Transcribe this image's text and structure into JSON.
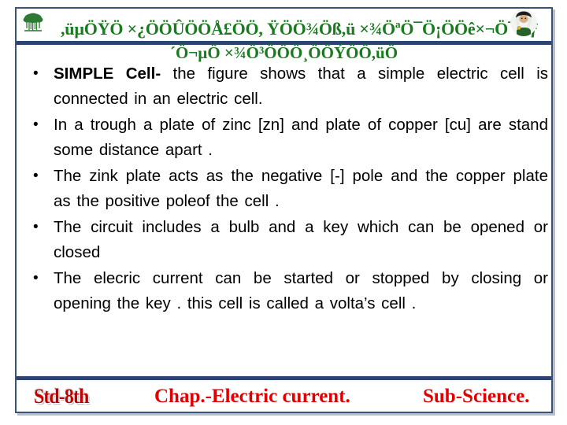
{
  "slide": {
    "header": {
      "title_line1": ",üµÖŸÖ ×¿ÖÖÛÖÖÅ£ÖÖ, ŸÖÖ¾Öß,ü ×¾ÖªÖ¯Ö¡ÖÖê×¬Ö¯Öƒ",
      "title_line2": "´Ö¬µÖ ×¾Ö³ÖÖÖ¸ÖÖÝÖÖ,üÖ",
      "tree_icon_label": "tree-icon",
      "sage_photo_label": "sage-photo"
    },
    "bullets": [
      {
        "lead": "SIMPLE Cell-",
        "text": " the figure shows that a simple electric cell is connected in an electric cell."
      },
      {
        "lead": "",
        "text": "In a trough  a plate of zinc [zn]  and plate of copper [cu] are stand some distance apart ."
      },
      {
        "lead": "",
        "text": "The zink plate acts as the  negative [-] pole  and the copper plate as the positive poleof the cell ."
      },
      {
        "lead": "",
        "text": "The circuit includes a bulb and a key which can be opened or closed"
      },
      {
        "lead": "",
        "text": "The  elecric current can be started or stopped  by closing or opening the key . this cell is called a  volta’s cell ."
      }
    ],
    "footer": {
      "standard": "Std-8th",
      "chapter": "Chap.-Electric current.",
      "subject": "Sub-Science."
    },
    "colors": {
      "frame_border": "#3c5378",
      "rule": "#2b4470",
      "header_green": "#1a7a1f",
      "footer_red": "#e00000",
      "badge_red": "#c00000",
      "body_text": "#000000",
      "background": "#ffffff"
    }
  }
}
